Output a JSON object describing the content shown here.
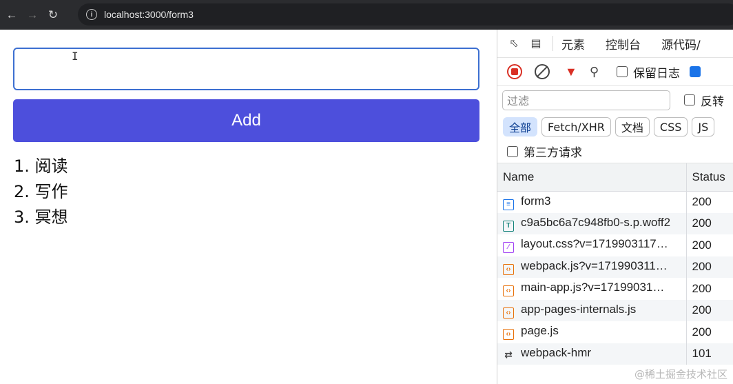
{
  "browser": {
    "url": "localhost:3000/form3",
    "icons": {
      "back": "arrow-left",
      "forward": "arrow-right",
      "reload": "reload",
      "info": "info"
    }
  },
  "page": {
    "input_value": "",
    "add_label": "Add",
    "todos": [
      "1. 阅读",
      "2. 写作",
      "3. 冥想"
    ],
    "accent": "#4d4fdc"
  },
  "devtools": {
    "tabs": [
      "元素",
      "控制台",
      "源代码/"
    ],
    "preserve_log": "保留日志",
    "filter_placeholder": "过滤",
    "invert": "反转",
    "chips": [
      "全部",
      "Fetch/XHR",
      "文档",
      "CSS",
      "JS"
    ],
    "third_party": "第三方请求",
    "columns": {
      "name": "Name",
      "status": "Status"
    },
    "requests": [
      {
        "name": "form3",
        "status": "200",
        "type": "doc"
      },
      {
        "name": "c9a5bc6a7c948fb0-s.p.woff2",
        "status": "200",
        "type": "font"
      },
      {
        "name": "layout.css?v=1719903117…",
        "status": "200",
        "type": "css"
      },
      {
        "name": "webpack.js?v=171990311…",
        "status": "200",
        "type": "js"
      },
      {
        "name": "main-app.js?v=17199031…",
        "status": "200",
        "type": "js"
      },
      {
        "name": "app-pages-internals.js",
        "status": "200",
        "type": "js"
      },
      {
        "name": "page.js",
        "status": "200",
        "type": "js"
      },
      {
        "name": "webpack-hmr",
        "status": "101",
        "type": "ws"
      }
    ]
  },
  "watermark": "@稀土掘金技术社区"
}
